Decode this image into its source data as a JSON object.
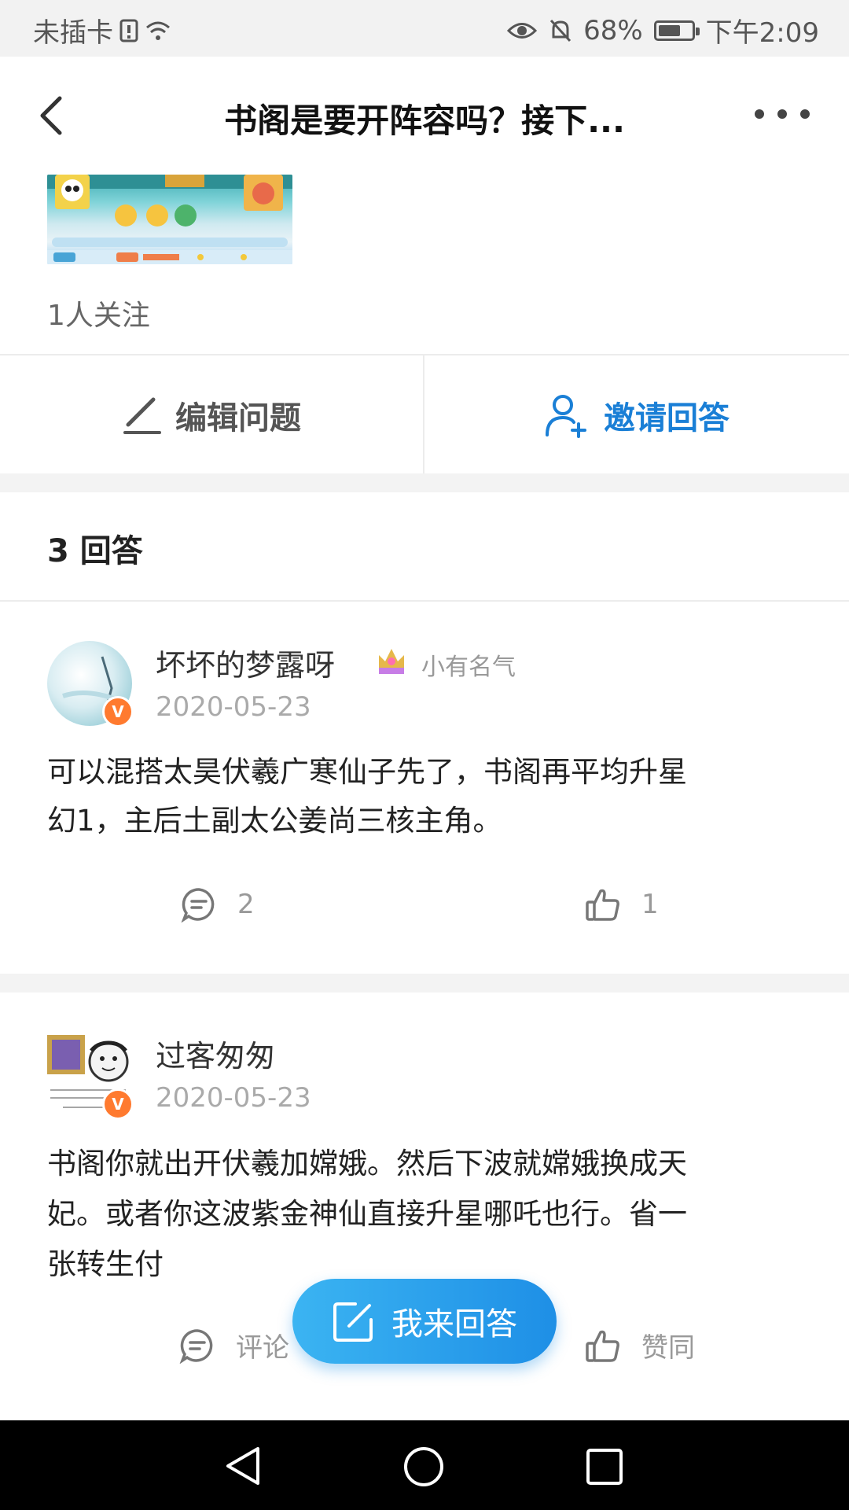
{
  "status_bar": {
    "carrier": "未插卡",
    "battery_percent": "68%",
    "battery_level": 0.68,
    "time": "下午2:09"
  },
  "header": {
    "title": "书阁是要开阵容吗？接下..."
  },
  "question": {
    "followers": "1人关注"
  },
  "actions": {
    "edit_label": "编辑问题",
    "invite_label": "邀请回答"
  },
  "answers_heading": {
    "count": "3",
    "label": "回答"
  },
  "answers": [
    {
      "username": "坏坏的梦露呀",
      "rank": "小有名气",
      "date": "2020-05-23",
      "body_line1": "可以混搭太昊伏羲广寒仙子先了，书阁再平均升星",
      "body_line2": "幻1，主后土副太公姜尚三核主角。",
      "comment_count": "2",
      "like_count": "1"
    },
    {
      "username": "过客匆匆",
      "date": "2020-05-23",
      "body_line1": "书阁你就出开伏羲加嫦娥。然后下波就嫦娥换成天",
      "body_line2": "妃。或者你这波紫金神仙直接升星哪吒也行。省一",
      "body_line3": "张转生付",
      "comment_label": "评论",
      "like_label": "赞同"
    }
  ],
  "fab": {
    "label": "我来回答"
  },
  "colors": {
    "accent": "#1a7fd6",
    "badge": "#ff7a2f",
    "fab": "#2a9fee"
  }
}
